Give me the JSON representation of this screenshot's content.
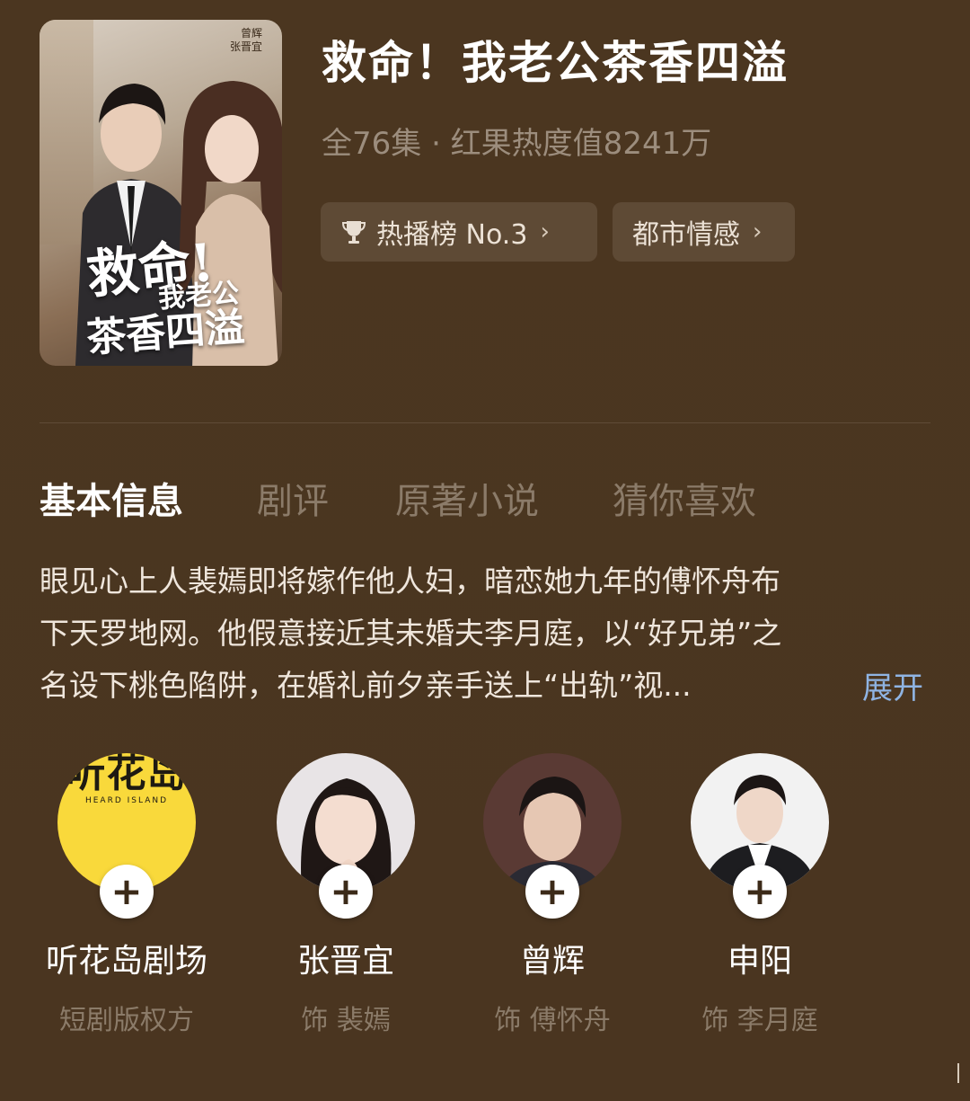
{
  "drama": {
    "title": "救命！我老公茶香四溢",
    "meta": "全76集 · 红果热度值8241万",
    "rank_chip": "热播榜 No.3",
    "genre_chip": "都市情感"
  },
  "poster": {
    "title_line1": "救命!",
    "title_line2": "我老公",
    "title_line3": "茶香四溢",
    "cast_names": [
      "曾辉",
      "张晋宜"
    ]
  },
  "tabs": [
    {
      "label": "基本信息",
      "active": true
    },
    {
      "label": "剧评",
      "active": false
    },
    {
      "label": "原著小说",
      "active": false
    },
    {
      "label": "猜你喜欢",
      "active": false
    }
  ],
  "synopsis": {
    "lines": [
      "眼见心上人裴嫣即将嫁作他人妇，暗恋她九年的傅怀舟布",
      "下天罗地网。他假意接近其未婚夫李月庭，以“好兄弟”之",
      "名设下桃色陷阱，在婚礼前夕亲手送上“出轨”视..."
    ],
    "expand_label": "展开"
  },
  "people": [
    {
      "name": "听花岛剧场",
      "role": "短剧版权方",
      "logo_text": "听花岛",
      "logo_sub": "HEARD ISLAND"
    },
    {
      "name": "张晋宜",
      "role": "饰 裴嫣"
    },
    {
      "name": "曾辉",
      "role": "饰 傅怀舟"
    },
    {
      "name": "申阳",
      "role": "饰 李月庭"
    }
  ],
  "icons": {
    "trophy": "trophy-icon",
    "chevron": "chevron-right-icon",
    "plus": "plus-icon"
  },
  "colors": {
    "background": "#4a3520",
    "chip": "#5e4a35",
    "muted_text": "#8b7b69",
    "link": "#8fb4e3",
    "logo_yellow": "#f9d93b"
  }
}
